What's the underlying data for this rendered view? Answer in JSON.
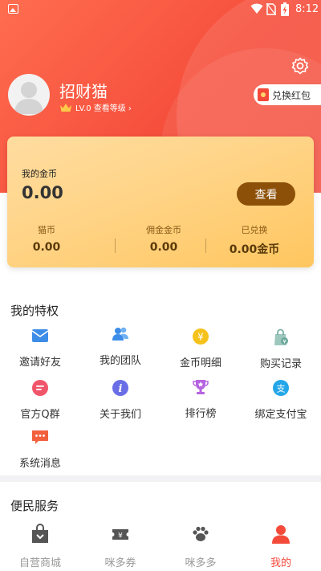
{
  "status_bar": {
    "time": "8:12"
  },
  "profile": {
    "name": "招财猫",
    "level_text": "LV.0 查看等级 ›",
    "redeem_label": "兑换红包"
  },
  "wallet": {
    "title": "我的金币",
    "amount": "0.00",
    "view_label": "查看",
    "stats": [
      {
        "label": "猫币",
        "value": "0.00"
      },
      {
        "label": "佣金金币",
        "value": "0.00"
      },
      {
        "label": "已兑换",
        "value": "0.00金币"
      }
    ]
  },
  "privileges": {
    "title": "我的特权",
    "items": [
      {
        "label": "邀请好友",
        "icon": "mail-icon"
      },
      {
        "label": "我的团队",
        "icon": "team-icon"
      },
      {
        "label": "金币明细",
        "icon": "coin-yen-icon"
      },
      {
        "label": "购买记录",
        "icon": "shopping-bag-icon"
      },
      {
        "label": "官方Q群",
        "icon": "chat-icon"
      },
      {
        "label": "关于我们",
        "icon": "info-icon"
      },
      {
        "label": "排行榜",
        "icon": "trophy-icon"
      },
      {
        "label": "绑定支付宝",
        "icon": "alipay-icon"
      },
      {
        "label": "系统消息",
        "icon": "message-icon"
      }
    ]
  },
  "services": {
    "title": "便民服务"
  },
  "bottom_nav": {
    "items": [
      {
        "label": "自营商城",
        "icon": "shop-bag-icon"
      },
      {
        "label": "咪多券",
        "icon": "coupon-icon"
      },
      {
        "label": "咪多多",
        "icon": "paw-icon"
      },
      {
        "label": "我的",
        "icon": "profile-icon",
        "active": true
      }
    ]
  },
  "colors": {
    "header": "#f6503d",
    "accent": "#f34a3a",
    "gold_card": "#ffd487",
    "view_button": "#8d5009"
  }
}
